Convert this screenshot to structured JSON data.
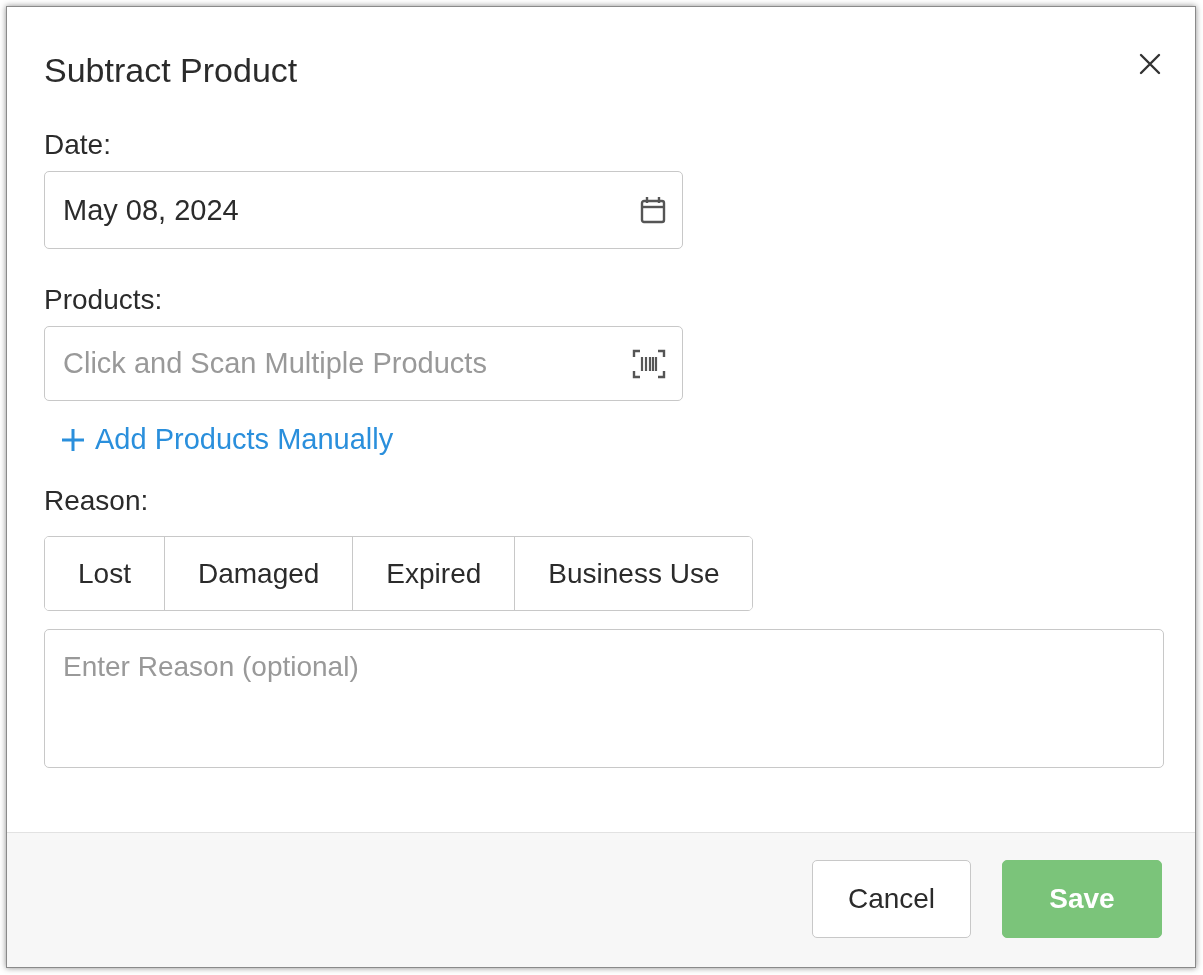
{
  "dialog": {
    "title": "Subtract Product"
  },
  "date": {
    "label": "Date:",
    "value": "May 08, 2024"
  },
  "products": {
    "label": "Products:",
    "placeholder": "Click and Scan Multiple Products",
    "add_link": "Add Products Manually"
  },
  "reason": {
    "label": "Reason:",
    "options": [
      {
        "label": "Lost",
        "selected": false
      },
      {
        "label": "Damaged",
        "selected": false
      },
      {
        "label": "Expired",
        "selected": false
      },
      {
        "label": "Business Use",
        "selected": false
      }
    ],
    "placeholder": "Enter Reason (optional)"
  },
  "buttons": [
    {
      "kind": "secondary",
      "label": "Cancel"
    },
    {
      "kind": "primary",
      "label": "Save"
    }
  ]
}
